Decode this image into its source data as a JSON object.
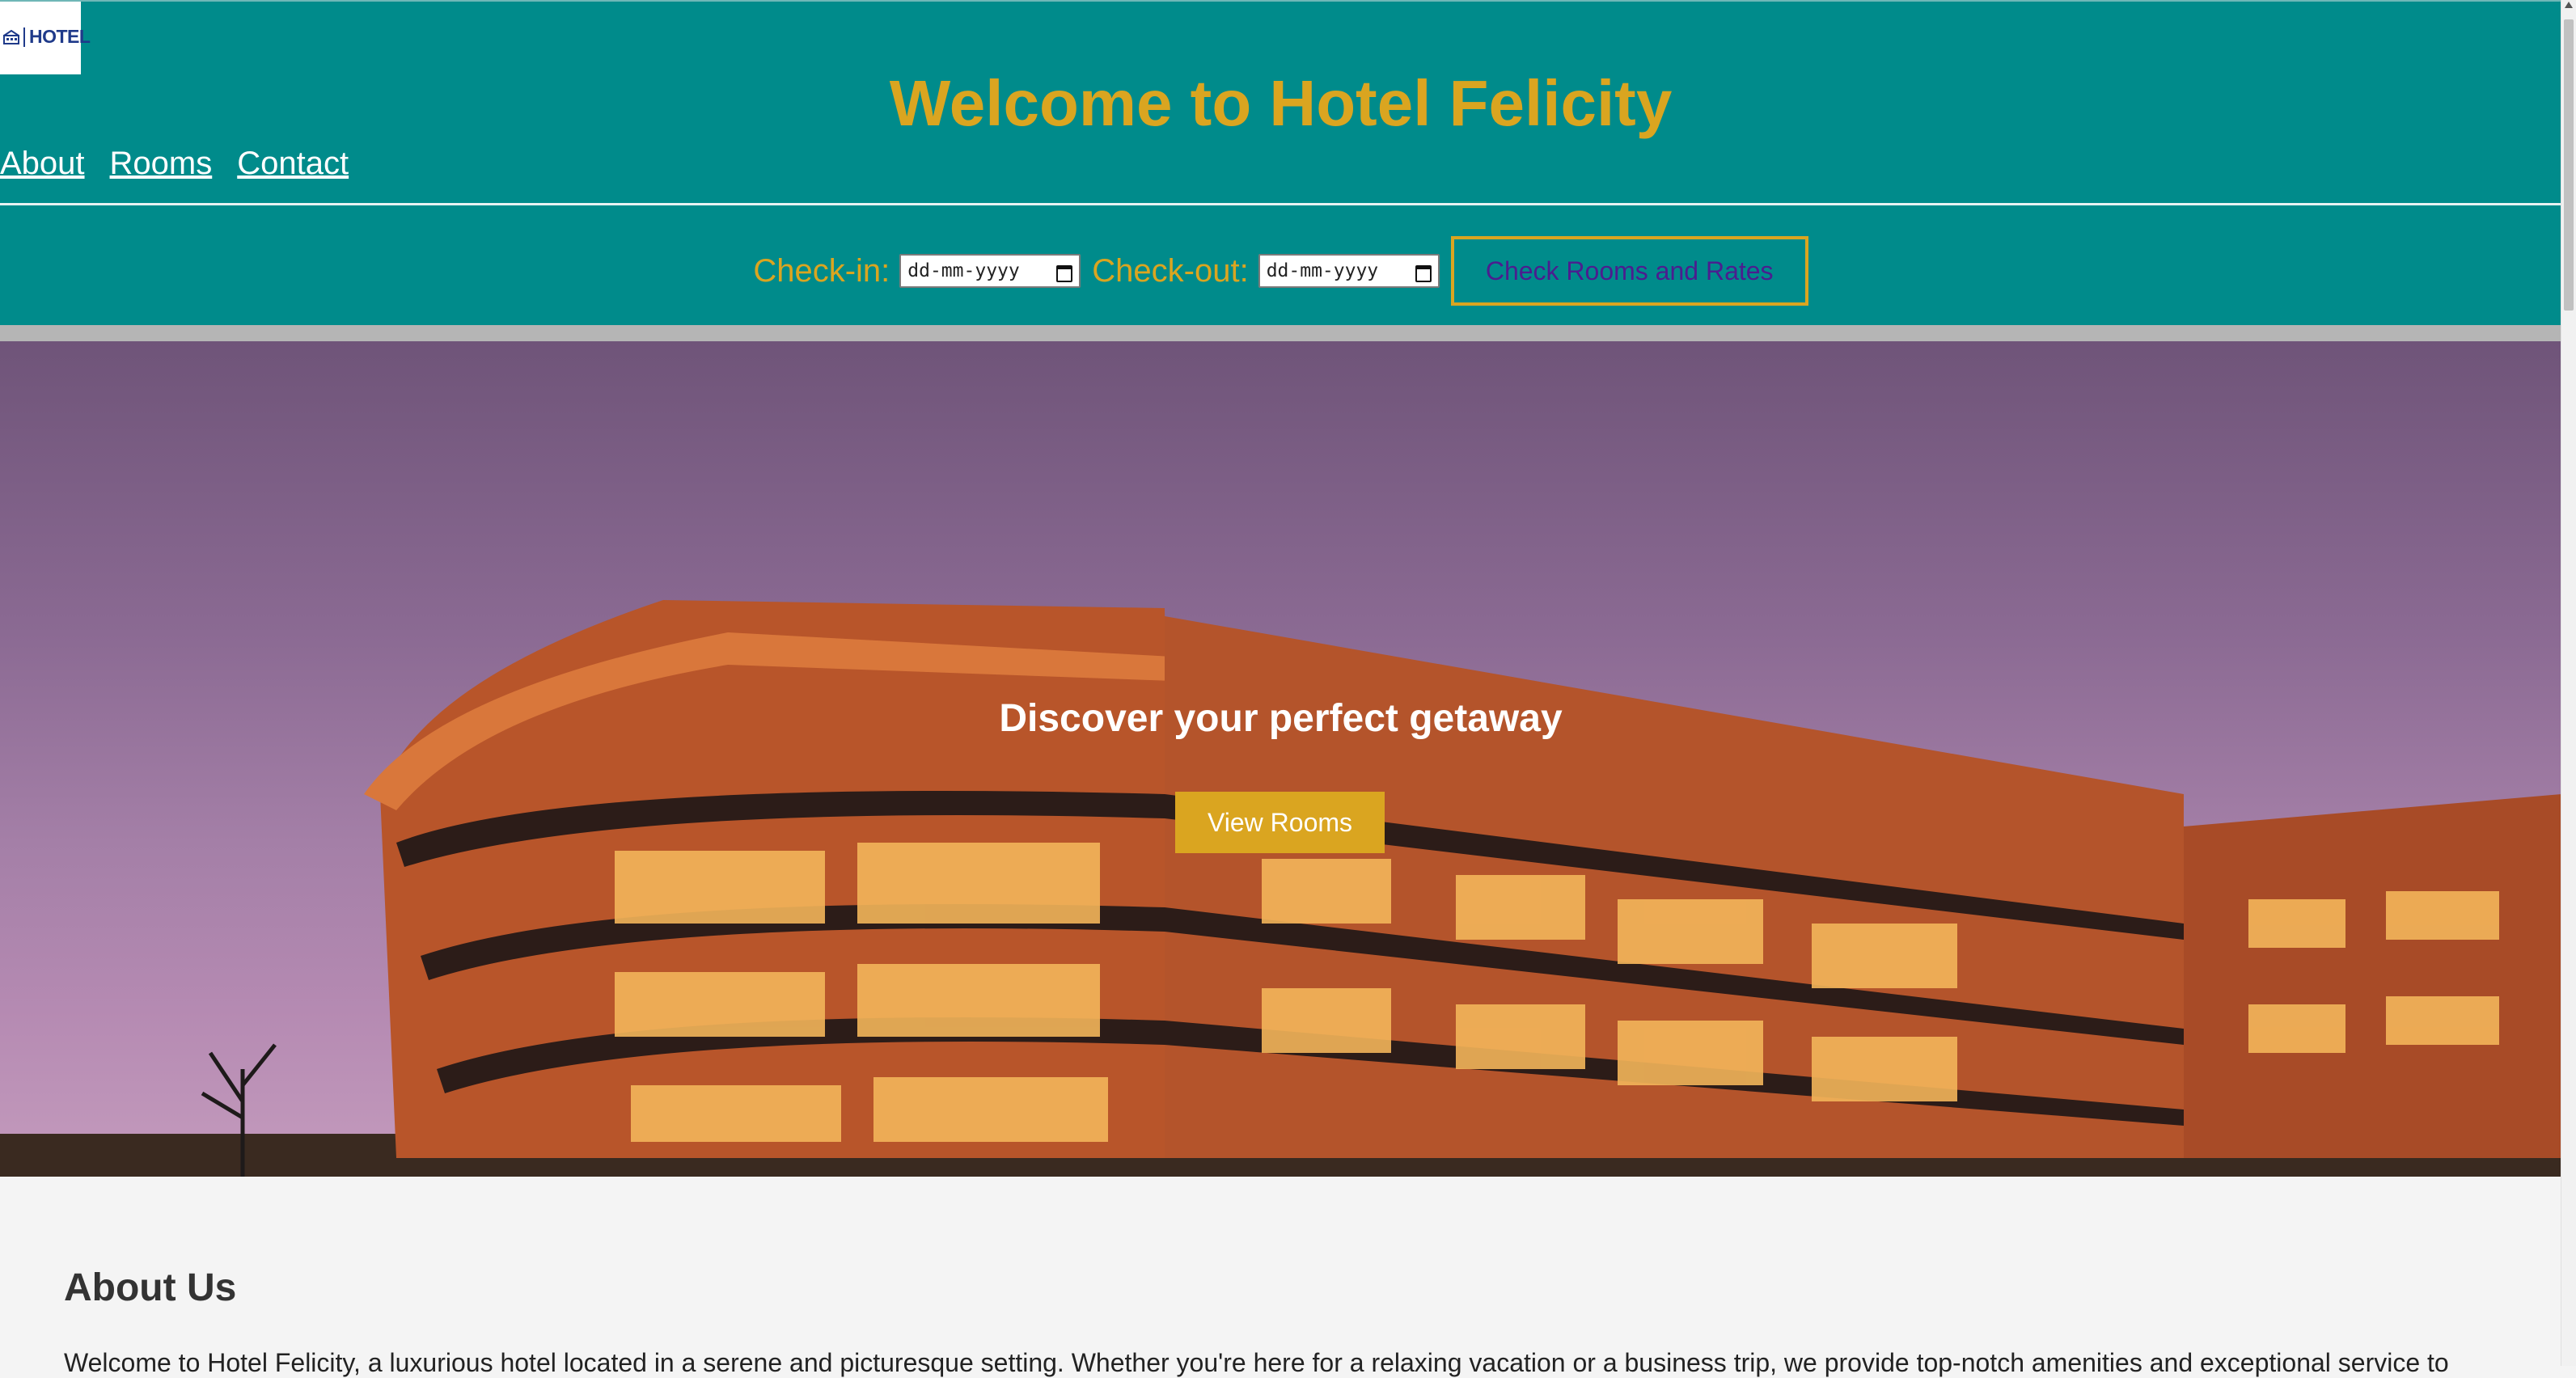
{
  "header": {
    "logo_text": "HOTEL",
    "title": "Welcome to Hotel Felicity",
    "nav": [
      {
        "label": "About"
      },
      {
        "label": "Rooms"
      },
      {
        "label": "Contact"
      }
    ]
  },
  "booking": {
    "checkin_label": "Check-in:",
    "checkin_value": "dd-mm-yyyy",
    "checkout_label": "Check-out:",
    "checkout_value": "dd-mm-yyyy",
    "button_label": "Check Rooms and Rates"
  },
  "hero": {
    "headline": "Discover your perfect getaway",
    "button_label": "View Rooms"
  },
  "about": {
    "heading": "About Us",
    "text": "Welcome to Hotel Felicity, a luxurious hotel located in a serene and picturesque setting. Whether you're here for a relaxing vacation or a business trip, we provide top-notch amenities and exceptional service to"
  },
  "colors": {
    "header_bg": "#008b8b",
    "accent_gold": "#daa520",
    "button_text_purple": "#4b1d8f"
  },
  "icons": [
    "hotel-logo-icon",
    "calendar-icon",
    "scroll-up-icon"
  ]
}
